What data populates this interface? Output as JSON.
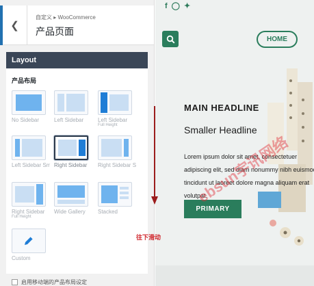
{
  "customizer": {
    "breadcrumb": "自定义 ▸ WooCommerce",
    "title": "产品页面",
    "section_title": "Layout",
    "section_label": "产品布局",
    "options": [
      {
        "label": "No Sidebar",
        "sub": ""
      },
      {
        "label": "Left Sidebar",
        "sub": ""
      },
      {
        "label": "Left Sidebar",
        "sub": "Full Height"
      },
      {
        "label": "Left Sidebar Small",
        "sub": ""
      },
      {
        "label": "Right Sidebar",
        "sub": ""
      },
      {
        "label": "Right Sidebar Small",
        "sub": ""
      },
      {
        "label": "Right Sidebar",
        "sub": "Full Height"
      },
      {
        "label": "Wide Gallery",
        "sub": ""
      },
      {
        "label": "Stacked",
        "sub": ""
      },
      {
        "label": "Custom",
        "sub": ""
      }
    ],
    "selected": "Right Sidebar",
    "checkbox_label": "启用移动端的产品布局设定"
  },
  "preview": {
    "home_label": "HOME",
    "headline": "MAIN HEADLINE",
    "subheadline": "Smaller Headline",
    "body": "Lorem ipsum dolor sit amet, consectetuer adipiscing elit, sed diam nonummy nibh euismod tincidunt ut laoreet dolore magna aliquam erat volutpat.",
    "primary_label": "PRIMARY",
    "social_icons": [
      "facebook-icon",
      "instagram-icon",
      "twitter-icon"
    ]
  },
  "annotation": {
    "scroll_hint": "往下滑动",
    "watermark": "ebsun宇讯网络"
  },
  "colors": {
    "accent": "#2a7d5c",
    "admin_bar": "#3a4657",
    "layout_blue": "#1f7dd6",
    "annotation_red": "#d0262c"
  }
}
